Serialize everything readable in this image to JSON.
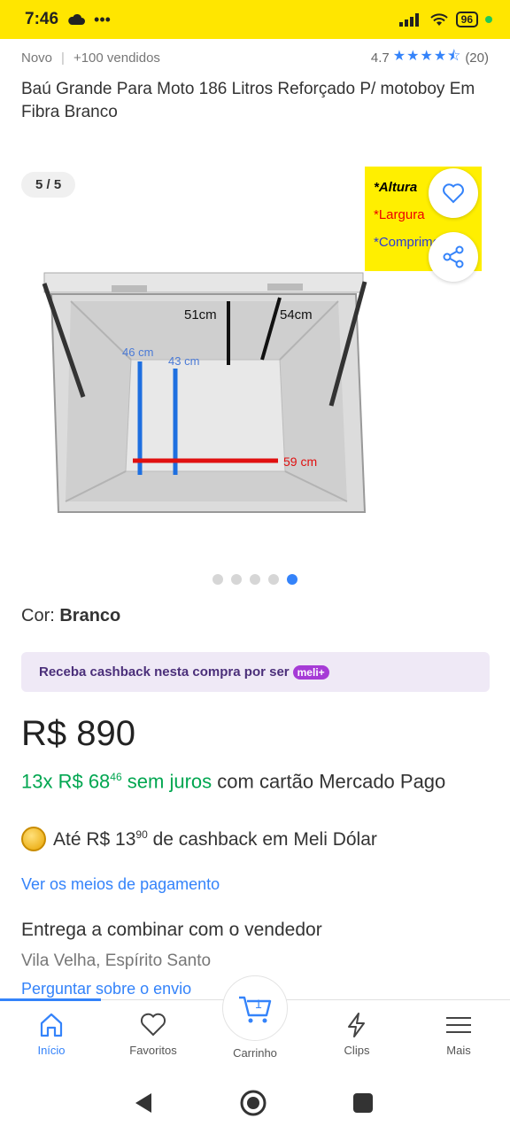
{
  "status_bar": {
    "time": "7:46",
    "battery": "96"
  },
  "product": {
    "condition": "Novo",
    "sold": "+100 vendidos",
    "rating": "4.7",
    "reviews": "(20)",
    "title": "Baú Grande Para Moto 186 Litros Reforçado P/ motoboy Em Fibra Branco"
  },
  "gallery": {
    "counter": "5 / 5",
    "current": 5,
    "total": 5,
    "note_lines": [
      "*Altura",
      "*Largura",
      "*Comprimento"
    ],
    "labels": {
      "height": "51cm",
      "depth": "54cm",
      "inner1": "46 cm",
      "inner2": "43 cm",
      "width": "59 cm"
    }
  },
  "color": {
    "label": "Cor:",
    "value": "Branco"
  },
  "cashback_banner": {
    "text": "Receba cashback nesta compra por ser",
    "badge": "meli+"
  },
  "price": {
    "main": "R$ 890",
    "installments_green": "13x R$ 68",
    "installments_cents": "46",
    "installments_green2": "sem juros",
    "installments_rest": "com cartão Mercado Pago"
  },
  "cashback_line": {
    "prefix": "Até R$ 13",
    "cents": "90",
    "suffix": "de cashback em Meli Dólar"
  },
  "links": {
    "payment": "Ver os meios de pagamento",
    "shipping": "Perguntar sobre o envio"
  },
  "delivery": {
    "title": "Entrega a combinar com o vendedor",
    "location": "Vila Velha, Espírito Santo"
  },
  "tabbar": {
    "home": "Início",
    "favorites": "Favoritos",
    "cart": "Carrinho",
    "cart_count": "1",
    "clips": "Clips",
    "more": "Mais"
  },
  "colors": {
    "brand_yellow": "#ffe600",
    "accent_blue": "#3483fa",
    "green": "#00a650"
  }
}
